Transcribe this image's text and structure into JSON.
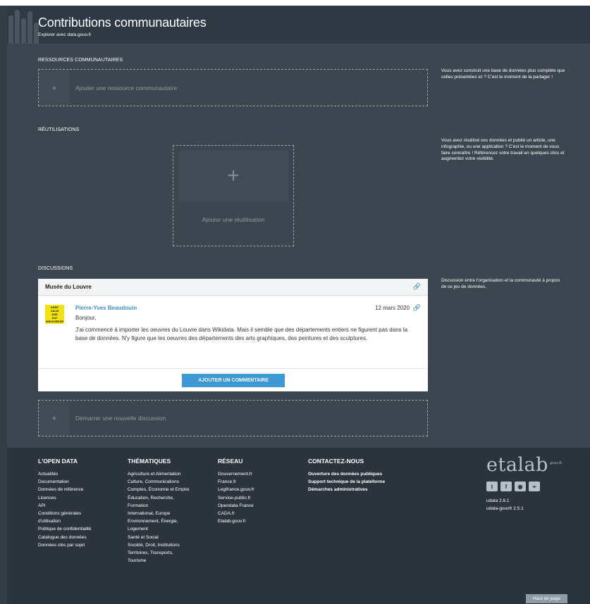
{
  "header": {
    "title": "Contributions communautaires",
    "subtitle": "Explorer avec data.gouv.fr"
  },
  "resources": {
    "section_title": "RESSOURCES COMMUNAUTAIRES",
    "add_label": "Ajouter une ressource communautaire",
    "side_text": "Vous avez construit une base de données plus complète que celles présentées ici ? C'est le moment de la partager !"
  },
  "reuses": {
    "section_title": "RÉUTILISATIONS",
    "add_label": "Ajouter une réutilisation",
    "side_text": "Vous avez réutilisé ces données et publié un article, une infographie, ou une application ? C'est le moment de vous faire connaître ! Référencez votre travail en quelques clics et augmentez votre visibilité."
  },
  "discussions": {
    "section_title": "DISCUSSIONS",
    "side_text": "Discussion entre l'organisation et la communauté à propos de ce jeu de données.",
    "thread": {
      "title": "Musée du Louvre",
      "author": "Pierre-Yves Beaudouin",
      "date": "12 mars 2020",
      "greeting": "Bonjour,",
      "body": "J'ai commencé à importer les oeuvres du Louvre dans Wikidata. Mais il semble que des départements entiers ne figurent pas dans la base de données. N'y figure que les oeuvres des départements des arts graphiques, des peintures et des sculptures.",
      "avatar_lines": [
        "KEEP",
        "CALM",
        "AND",
        "SAY",
        "WIKICHEESE"
      ],
      "comment_button": "AJOUTER UN COMMENTAIRE"
    },
    "new_discussion_label": "Démarrer une nouvelle discussion"
  },
  "footer": {
    "columns": [
      {
        "title": "L'OPEN DATA",
        "links": [
          "Actualités",
          "Documentation",
          "Données de référence",
          "Licences",
          "API",
          "Conditions générales",
          "d'utilisation",
          "Politique de confidentialité",
          "Catalogue des données",
          "Données clés par sujet"
        ]
      },
      {
        "title": "THÉMATIQUES",
        "links": [
          "Agriculture et Alimentation",
          "Culture, Communications",
          "Comptes, Économie et Emploi",
          "Éducation, Recherche,",
          "Formation",
          "International, Europe",
          "Environnement, Énergie,",
          "Logement",
          "Santé et Social",
          "Société, Droit, Institutions",
          "Territoires, Transports,",
          "Tourisme"
        ]
      },
      {
        "title": "RÉSEAU",
        "links": [
          "Gouvernement.fr",
          "France.fr",
          "Legifrance.gouv.fr",
          "Service-public.fr",
          "Opendata France",
          "CADA.fr",
          "Etalab.gouv.fr"
        ]
      },
      {
        "title": "CONTACTEZ-NOUS",
        "links": [
          "Ouverture des données publiques",
          "Support technique de la plateforme",
          "Démarches administratives"
        ]
      }
    ],
    "brand": "etalab",
    "brand_sup": "gouv.fr",
    "socials": [
      "twitter-icon",
      "facebook-icon",
      "github-icon",
      "rss-icon"
    ],
    "versions": [
      "udata 2.6.1",
      "udata-gouvfr 2.5.1"
    ],
    "back_to_top": "Haut de page"
  },
  "colors": {
    "background": "#333d46",
    "panel": "#3b4650",
    "footer": "#2b343d",
    "accent": "#3d98d4"
  }
}
